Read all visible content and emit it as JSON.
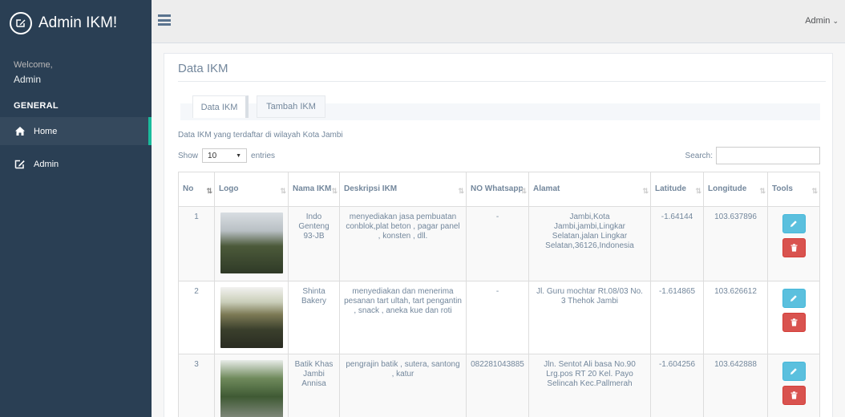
{
  "brand": {
    "title": "Admin IKM!",
    "icon": "edit-icon"
  },
  "profile": {
    "welcome": "Welcome,",
    "name": "Admin"
  },
  "sidebar": {
    "section_title": "GENERAL",
    "items": [
      {
        "label": "Home",
        "icon": "home-icon",
        "active": true
      },
      {
        "label": "Admin",
        "icon": "edit-icon",
        "active": false
      }
    ]
  },
  "topnav": {
    "user_label": "Admin",
    "menu_icon": "hamburger-icon"
  },
  "page": {
    "title": "Data IKM",
    "tabs": [
      {
        "label": "Data IKM",
        "active": true
      },
      {
        "label": "Tambah IKM",
        "active": false
      }
    ],
    "caption": "Data IKM yang terdaftar di wilayah Kota Jambi",
    "show_label": "Show",
    "entries_value": "10",
    "entries_label": "entries",
    "search_label": "Search:"
  },
  "table": {
    "columns": [
      "No",
      "Logo",
      "Nama IKM",
      "Deskripsi IKM",
      "NO Whatsapp",
      "Alamat",
      "Latitude",
      "Longitude",
      "Tools"
    ],
    "rows": [
      {
        "no": "1",
        "nama": "Indo Genteng 93-JB",
        "deskripsi": "menyediakan jasa pembuatan conblok,plat beton , pagar panel , konsten , dll.",
        "whatsapp": "-",
        "alamat": "Jambi,Kota Jambi,jambi,Lingkar Selatan,jalan Lingkar Selatan,36126,Indonesia",
        "latitude": "-1.64144",
        "longitude": "103.637896"
      },
      {
        "no": "2",
        "nama": "Shinta Bakery",
        "deskripsi": "menyediakan dan menerima pesanan tart ultah, tart pengantin , snack , aneka kue dan roti",
        "whatsapp": "-",
        "alamat": "Jl. Guru mochtar Rt.08/03 No. 3 Thehok Jambi",
        "latitude": "-1.614865",
        "longitude": "103.626612"
      },
      {
        "no": "3",
        "nama": "Batik Khas Jambi Annisa",
        "deskripsi": "pengrajin batik , sutera, santong , katur",
        "whatsapp": "082281043885",
        "alamat": "Jln. Sentot Ali basa No.90 Lrg.pos RT 20 Kel. Payo Selincah Kec.Pallmerah",
        "latitude": "-1.604256",
        "longitude": "103.642888"
      }
    ]
  },
  "colors": {
    "sidebar": "#2A3F54",
    "accent": "#1ABB9C",
    "edit": "#5BC0DE",
    "delete": "#D9534F"
  }
}
